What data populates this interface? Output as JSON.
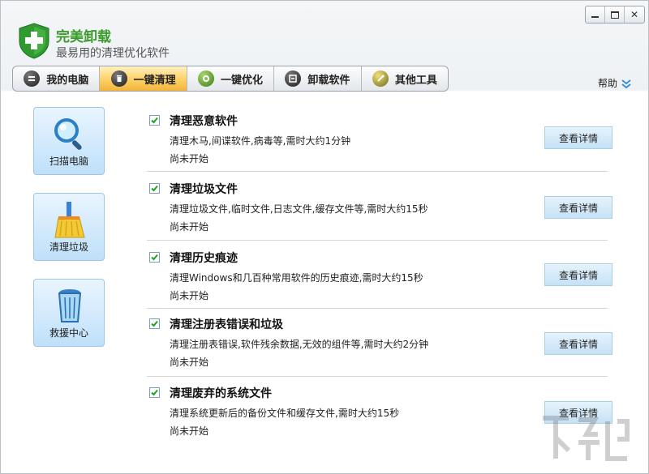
{
  "app": {
    "title": "完美卸载",
    "subtitle": "最易用的清理优化软件"
  },
  "window_controls": {
    "minimize": "☐",
    "maximize": "□",
    "close": "✕"
  },
  "tabs": [
    {
      "label": "我的电脑",
      "icon": "computer-icon",
      "active": false
    },
    {
      "label": "一键清理",
      "icon": "trash-icon",
      "active": true
    },
    {
      "label": "一键优化",
      "icon": "gear-icon",
      "active": false
    },
    {
      "label": "卸载软件",
      "icon": "uninstall-icon",
      "active": false
    },
    {
      "label": "其他工具",
      "icon": "tools-icon",
      "active": false
    }
  ],
  "help": {
    "label": "帮助",
    "icon": "chevron-down-icon"
  },
  "sidebar": [
    {
      "label": "扫描电脑",
      "icon": "magnifier-icon"
    },
    {
      "label": "清理垃圾",
      "icon": "broom-icon"
    },
    {
      "label": "救援中心",
      "icon": "recycle-bin-icon"
    }
  ],
  "items": [
    {
      "title": "清理恶意软件",
      "desc": "清理木马,间谍软件,病毒等,需时大约1分钟",
      "status": "尚未开始",
      "checked": true,
      "button": "查看详情"
    },
    {
      "title": "清理垃圾文件",
      "desc": "清理垃圾文件,临时文件,日志文件,缓存文件等,需时大约15秒",
      "status": "尚未开始",
      "checked": true,
      "button": "查看详情"
    },
    {
      "title": "清理历史痕迹",
      "desc": "清理Windows和几百种常用软件的历史痕迹,需时大约15秒",
      "status": "尚未开始",
      "checked": true,
      "button": "查看详情"
    },
    {
      "title": "清理注册表错误和垃圾",
      "desc": "清理注册表错误,软件残余数据,无效的组件等,需时大约2分钟",
      "status": "尚未开始",
      "checked": true,
      "button": "查看详情"
    },
    {
      "title": "清理废弃的系统文件",
      "desc": "清理系统更新后的备份文件和缓存文件,需时大约15秒",
      "status": "尚未开始",
      "checked": true,
      "button": "查看详情"
    }
  ],
  "colors": {
    "brand_green": "#3a9b2a",
    "active_tab": "#ffd36a",
    "panel_blue": "#bfe0fa"
  }
}
